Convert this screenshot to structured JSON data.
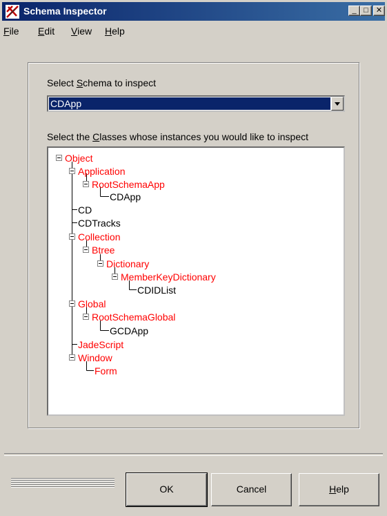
{
  "window": {
    "title": "Schema Inspector"
  },
  "menu": {
    "file": {
      "u": "F",
      "rest": "ile"
    },
    "edit": {
      "u": "E",
      "rest": "dit"
    },
    "view": {
      "u": "V",
      "rest": "iew"
    },
    "help": {
      "u": "H",
      "rest": "elp"
    }
  },
  "schema": {
    "label_pre": "Select ",
    "label_u": "S",
    "label_post": "chema to inspect",
    "selected": "CDApp"
  },
  "classes": {
    "label_pre": "Select the ",
    "label_u": "C",
    "label_post": "lasses whose instances you would like to inspect"
  },
  "tree": [
    "Object",
    "Application",
    "RootSchemaApp",
    "CDApp",
    "CD",
    "CDTracks",
    "Collection",
    "Btree",
    "Dictionary",
    "MemberKeyDictionary",
    "CDIDList",
    "Global",
    "RootSchemaGlobal",
    "GCDApp",
    "JadeScript",
    "Window",
    "Form"
  ],
  "buttons": {
    "ok": "OK",
    "cancel": "Cancel",
    "help": {
      "u": "H",
      "rest": "elp"
    }
  }
}
